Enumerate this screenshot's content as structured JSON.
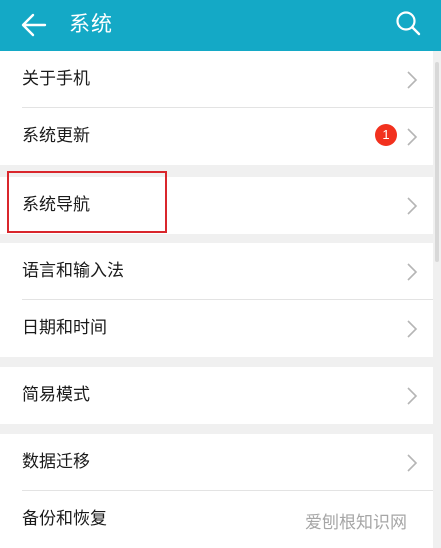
{
  "header": {
    "title": "系统",
    "back_icon": "back-arrow-icon",
    "search_icon": "search-icon"
  },
  "menu_groups": [
    {
      "items": [
        {
          "label": "关于手机"
        },
        {
          "label": "系统更新",
          "badge": "1"
        }
      ]
    },
    {
      "items": [
        {
          "label": "系统导航",
          "highlighted": true
        }
      ]
    },
    {
      "items": [
        {
          "label": "语言和输入法"
        },
        {
          "label": "日期和时间"
        }
      ]
    },
    {
      "items": [
        {
          "label": "简易模式"
        }
      ]
    },
    {
      "items": [
        {
          "label": "数据迁移"
        },
        {
          "label": "备份和恢复"
        }
      ]
    }
  ],
  "watermark": {
    "text": "爱刨根知识网"
  },
  "colors": {
    "header_bg": "#14a9c6",
    "badge": "#f2311e",
    "highlight_border": "#d9262c"
  }
}
